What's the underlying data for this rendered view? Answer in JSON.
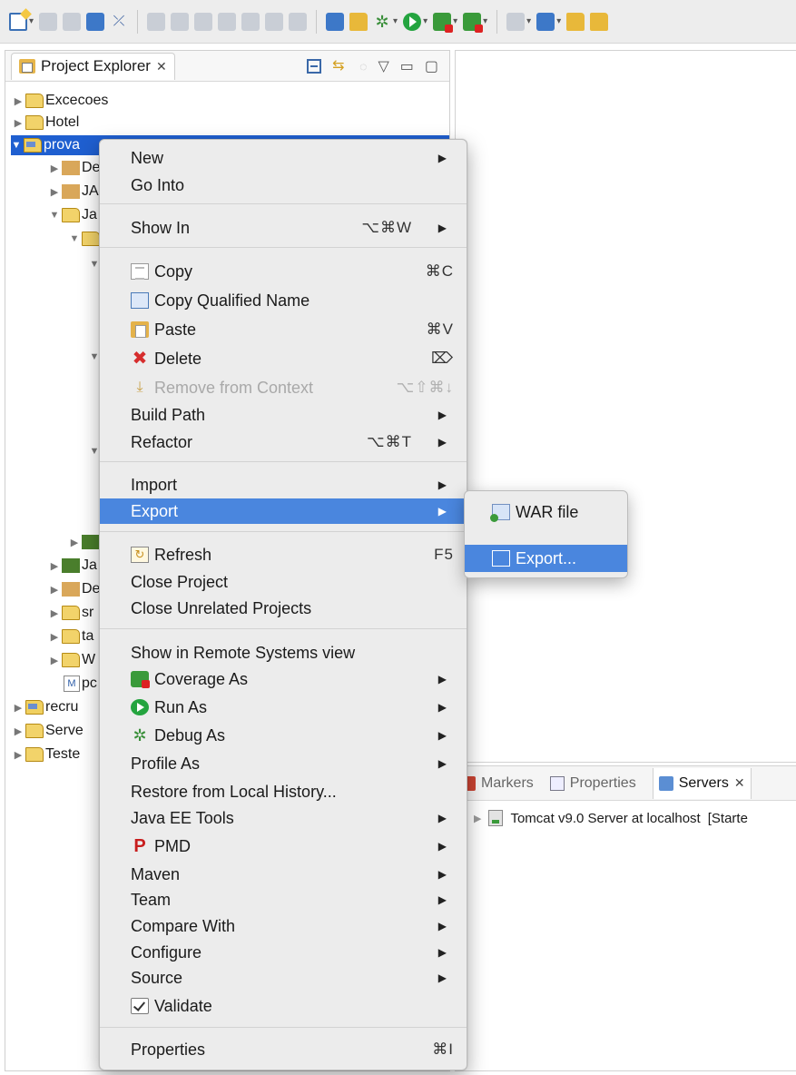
{
  "project_explorer": {
    "tab_title": "Project Explorer"
  },
  "tree": {
    "items": [
      {
        "label": "Excecoes"
      },
      {
        "label": "Hotel"
      },
      {
        "label": "prova"
      },
      {
        "label": "De"
      },
      {
        "label": "JA"
      },
      {
        "label": "Ja"
      },
      {
        "label": "Ja"
      },
      {
        "label": "De"
      },
      {
        "label": "sr"
      },
      {
        "label": "ta"
      },
      {
        "label": "W"
      },
      {
        "label": "pc"
      },
      {
        "label": "recru"
      },
      {
        "label": "Serve"
      },
      {
        "label": "Teste"
      }
    ]
  },
  "context_menu": {
    "items": [
      {
        "label": "New",
        "shortcut": "",
        "submenu": true
      },
      {
        "label": "Go Into",
        "shortcut": ""
      },
      {
        "label": "Show In",
        "shortcut": "⌥⌘W",
        "submenu": true
      },
      {
        "label": "Copy",
        "shortcut": "⌘C",
        "icon": "copy-icon"
      },
      {
        "label": "Copy Qualified Name",
        "shortcut": "",
        "icon": "copy-qualified-name-icon"
      },
      {
        "label": "Paste",
        "shortcut": "⌘V",
        "icon": "paste-icon"
      },
      {
        "label": "Delete",
        "shortcut": "⌦",
        "icon": "delete-icon"
      },
      {
        "label": "Remove from Context",
        "shortcut": "⌥⇧⌘↓",
        "icon": "remove-context-icon",
        "disabled": true
      },
      {
        "label": "Build Path",
        "shortcut": "",
        "submenu": true
      },
      {
        "label": "Refactor",
        "shortcut": "⌥⌘T",
        "submenu": true
      },
      {
        "label": "Import",
        "shortcut": "",
        "submenu": true
      },
      {
        "label": "Export",
        "shortcut": "",
        "submenu": true,
        "highlighted": true
      },
      {
        "label": "Refresh",
        "shortcut": "F5",
        "icon": "refresh-icon"
      },
      {
        "label": "Close Project",
        "shortcut": ""
      },
      {
        "label": "Close Unrelated Projects",
        "shortcut": ""
      },
      {
        "label": "Show in Remote Systems view",
        "shortcut": ""
      },
      {
        "label": "Coverage As",
        "shortcut": "",
        "submenu": true,
        "icon": "coverage-icon"
      },
      {
        "label": "Run As",
        "shortcut": "",
        "submenu": true,
        "icon": "run-icon"
      },
      {
        "label": "Debug As",
        "shortcut": "",
        "submenu": true,
        "icon": "debug-icon"
      },
      {
        "label": "Profile As",
        "shortcut": "",
        "submenu": true
      },
      {
        "label": "Restore from Local History...",
        "shortcut": ""
      },
      {
        "label": "Java EE Tools",
        "shortcut": "",
        "submenu": true
      },
      {
        "label": "PMD",
        "shortcut": "",
        "submenu": true,
        "icon": "pmd-icon"
      },
      {
        "label": "Maven",
        "shortcut": "",
        "submenu": true
      },
      {
        "label": "Team",
        "shortcut": "",
        "submenu": true
      },
      {
        "label": "Compare With",
        "shortcut": "",
        "submenu": true
      },
      {
        "label": "Configure",
        "shortcut": "",
        "submenu": true
      },
      {
        "label": "Source",
        "shortcut": "",
        "submenu": true
      },
      {
        "label": "Validate",
        "shortcut": "",
        "icon": "checkbox-icon"
      },
      {
        "label": "Properties",
        "shortcut": "⌘I"
      }
    ]
  },
  "export_submenu": {
    "items": [
      {
        "label": "WAR file",
        "highlighted": false
      },
      {
        "label": "Export...",
        "highlighted": true
      }
    ]
  },
  "servers_panel": {
    "tabs": [
      {
        "label": "Markers",
        "active": false
      },
      {
        "label": "Properties",
        "active": false
      },
      {
        "label": "Servers",
        "active": true
      }
    ],
    "rows": [
      {
        "label": "Tomcat v9.0 Server at localhost",
        "status": "[Starte"
      }
    ]
  },
  "colors": {
    "selection": "#1f5fd0",
    "menu_highlight": "#4a86de",
    "menu_background": "#ececec"
  }
}
